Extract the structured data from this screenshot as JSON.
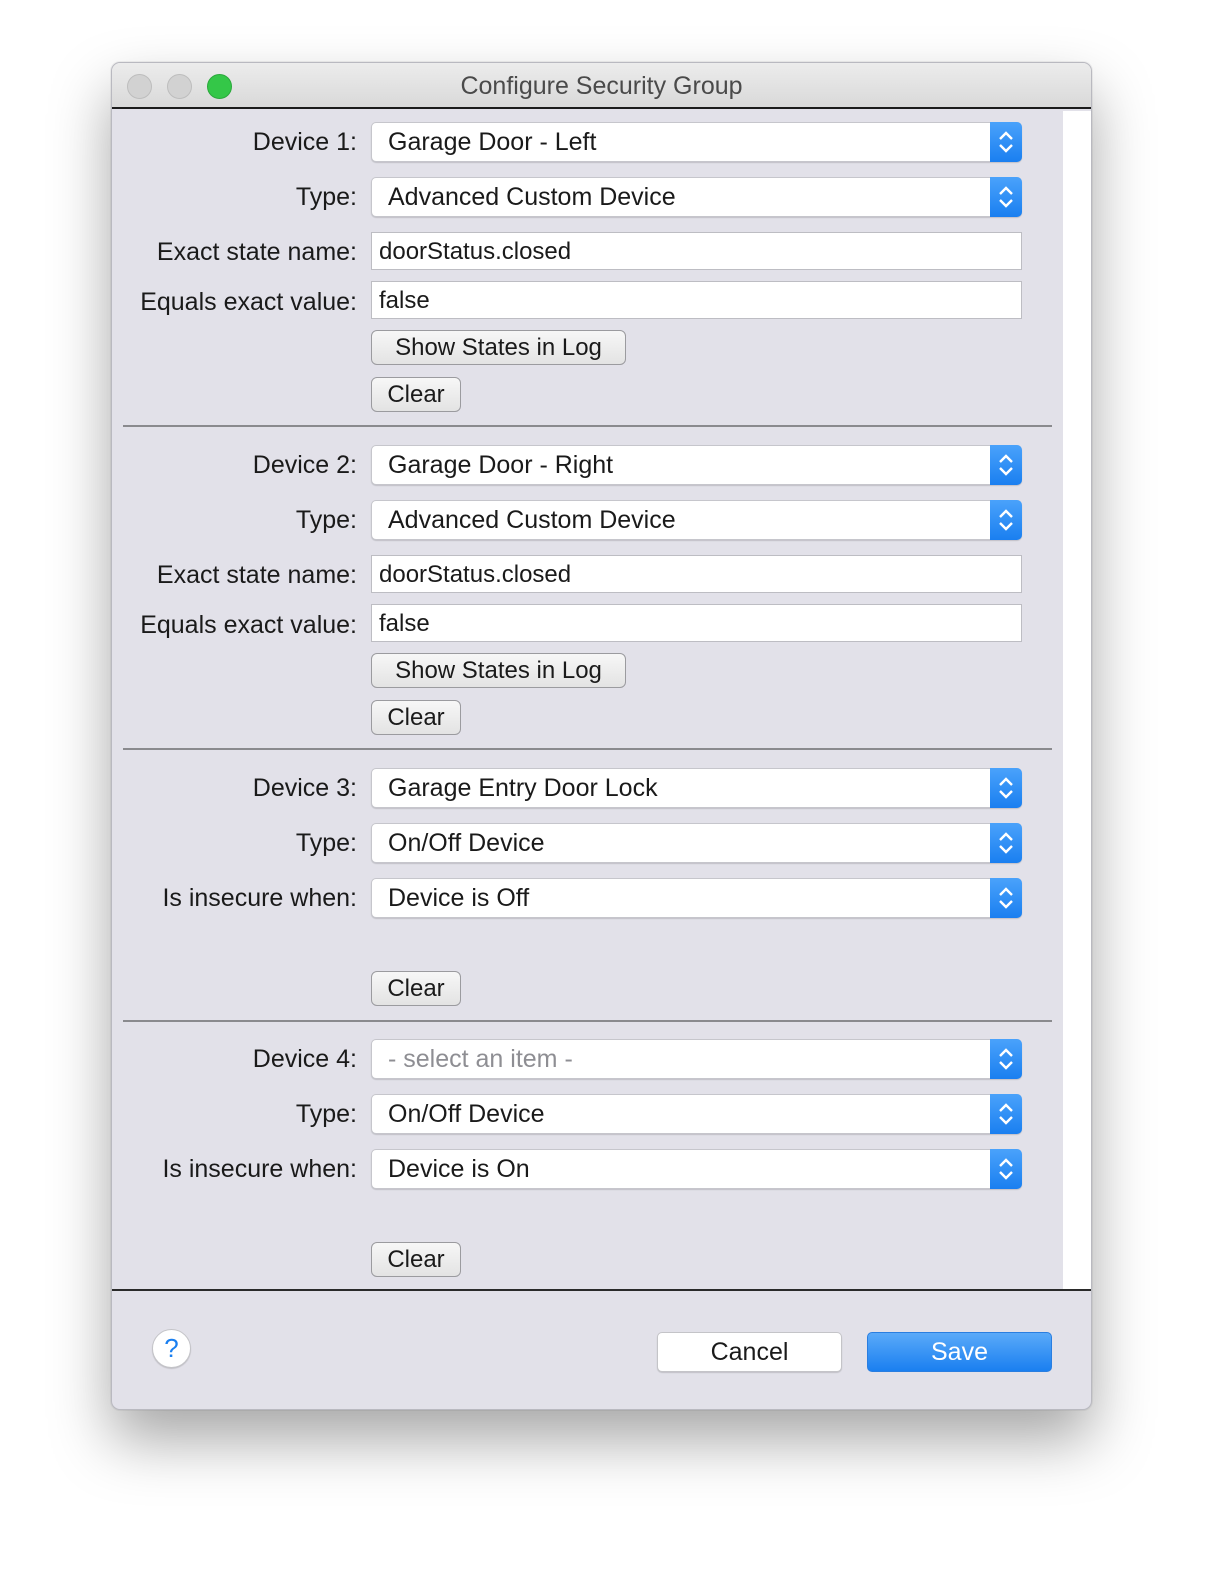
{
  "window": {
    "title": "Configure Security Group"
  },
  "devices": [
    {
      "device_label": "Device 1:",
      "device_value": "Garage Door - Left",
      "type_label": "Type:",
      "type_value": "Advanced Custom Device",
      "state_label": "Exact state name:",
      "state_value": "doorStatus.closed",
      "equals_label": "Equals exact value:",
      "equals_value": "false",
      "show_log_label": "Show States in Log",
      "clear_label": "Clear"
    },
    {
      "device_label": "Device 2:",
      "device_value": "Garage Door - Right",
      "type_label": "Type:",
      "type_value": "Advanced Custom Device",
      "state_label": "Exact state name:",
      "state_value": "doorStatus.closed",
      "equals_label": "Equals exact value:",
      "equals_value": "false",
      "show_log_label": "Show States in Log",
      "clear_label": "Clear"
    },
    {
      "device_label": "Device 3:",
      "device_value": "Garage Entry Door Lock",
      "type_label": "Type:",
      "type_value": "On/Off Device",
      "insecure_label": "Is insecure when:",
      "insecure_value": "Device is Off",
      "clear_label": "Clear"
    },
    {
      "device_label": "Device 4:",
      "device_value": "- select an item -",
      "type_label": "Type:",
      "type_value": "On/Off Device",
      "insecure_label": "Is insecure when:",
      "insecure_value": "Device is On",
      "clear_label": "Clear"
    }
  ],
  "footer": {
    "help_label": "?",
    "cancel_label": "Cancel",
    "save_label": "Save"
  },
  "colors": {
    "accent": "#1a7ff0",
    "zoom_button": "#34c748",
    "window_bg": "#e2e1e9"
  },
  "icons": [
    "stepper-icon",
    "help-icon"
  ]
}
